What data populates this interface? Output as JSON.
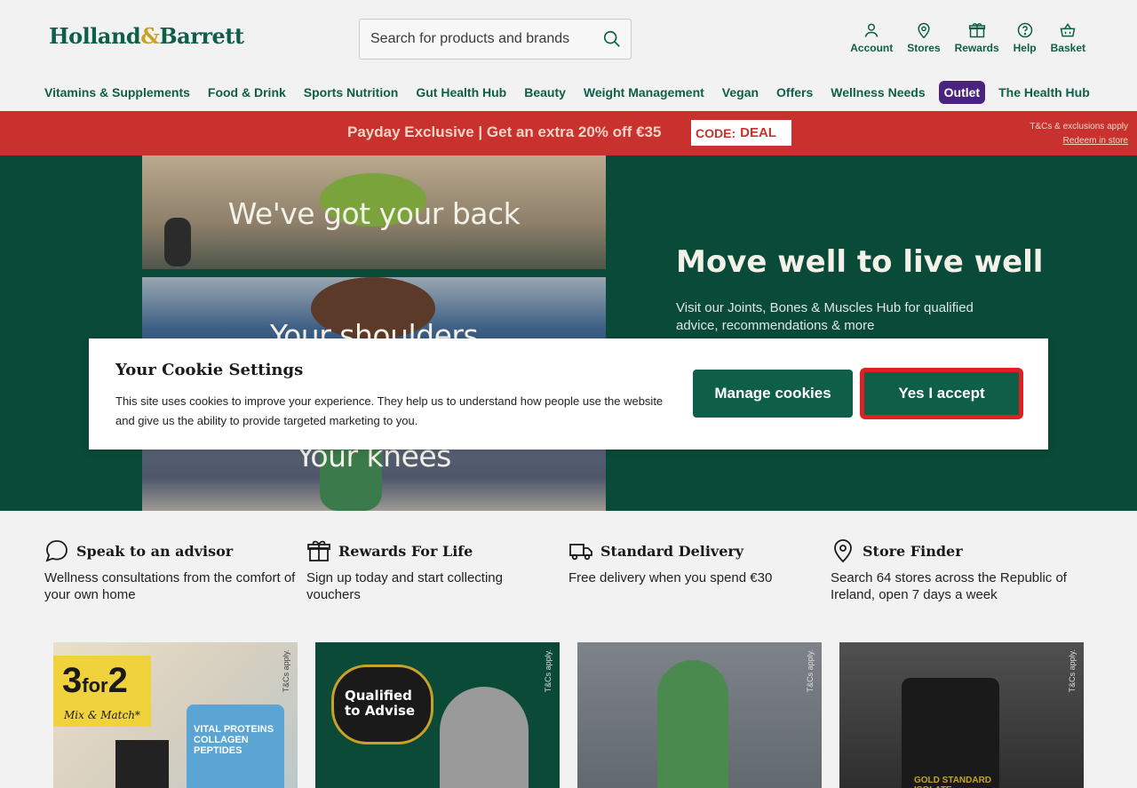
{
  "brand": {
    "logo_part1": "Holland",
    "logo_amp": "&",
    "logo_part2": "Barrett"
  },
  "search": {
    "placeholder": "Search for products and brands"
  },
  "utils": [
    {
      "label": "Account",
      "icon": "user-icon"
    },
    {
      "label": "Stores",
      "icon": "location-icon"
    },
    {
      "label": "Rewards",
      "icon": "gift-icon"
    },
    {
      "label": "Help",
      "icon": "help-icon"
    },
    {
      "label": "Basket",
      "icon": "basket-icon"
    }
  ],
  "nav": [
    "Vitamins & Supplements",
    "Food & Drink",
    "Sports Nutrition",
    "Gut Health Hub",
    "Beauty",
    "Weight Management",
    "Vegan",
    "Offers",
    "Wellness Needs",
    "Outlet",
    "The Health Hub"
  ],
  "promo": {
    "text": "Payday Exclusive | Get an extra 20% off €35",
    "code_label": "CODE:",
    "code_value": "DEAL",
    "tc": "T&Cs & exclusions apply",
    "redeem": "Redeem in store"
  },
  "hero": {
    "panel1": "We've got your back",
    "panel2": "Your shoulders",
    "panel3": "Your knees",
    "title": "Move well to live well",
    "subtitle": "Visit our Joints, Bones & Muscles Hub for qualified advice, recommendations & more"
  },
  "cookie": {
    "title": "Your Cookie Settings",
    "desc": "This site uses cookies to improve your experience. They help us to understand how people use the website and give us the ability to provide targeted marketing to you.",
    "manage": "Manage cookies",
    "accept": "Yes I accept"
  },
  "features": [
    {
      "title": "Speak to an advisor",
      "desc": "Wellness consultations from the comfort of your own home",
      "icon": "chat-icon"
    },
    {
      "title": "Rewards For Life",
      "desc": "Sign up today and start collecting vouchers",
      "icon": "gift-icon"
    },
    {
      "title": "Standard Delivery",
      "desc": "Free delivery when you spend €30",
      "icon": "truck-icon"
    },
    {
      "title": "Store Finder",
      "desc": "Search 64 stores across the Republic of Ireland, open 7 days a week",
      "icon": "location-icon"
    }
  ],
  "cards": {
    "tc": "T&Cs apply.",
    "c1_deal_a": "3",
    "c1_deal_b": "for",
    "c1_deal_c": "2",
    "c1_mix": "Mix & Match*",
    "c1_jar": "VITAL PROTEINS COLLAGEN PEPTIDES",
    "c2_bubble": "Qualified to Advise",
    "c4_tub": "GOLD STANDARD ISOLATE"
  },
  "colors": {
    "brand_green": "#0f5e47",
    "promo_red": "#c8312e",
    "outlet_purple": "#4a2380",
    "hero_green": "#0a4a38"
  }
}
